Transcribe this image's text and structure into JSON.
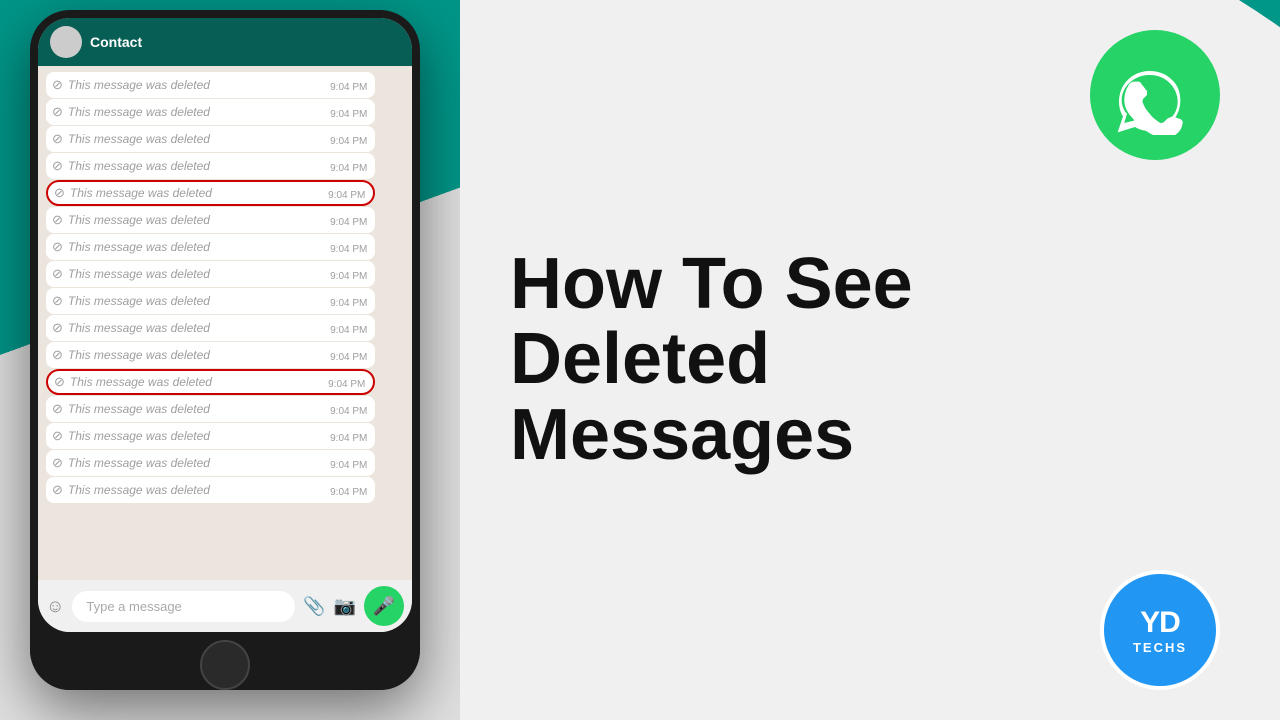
{
  "left": {
    "messages": [
      {
        "text": "This message was deleted",
        "time": "9:04 PM",
        "circled": false
      },
      {
        "text": "This message was deleted",
        "time": "9:04 PM",
        "circled": false
      },
      {
        "text": "This message was deleted",
        "time": "9:04 PM",
        "circled": false
      },
      {
        "text": "This message was deleted",
        "time": "9:04 PM",
        "circled": false
      },
      {
        "text": "This message was deleted",
        "time": "9:04 PM",
        "circled": true
      },
      {
        "text": "This message was deleted",
        "time": "9:04 PM",
        "circled": false
      },
      {
        "text": "This message was deleted",
        "time": "9:04 PM",
        "circled": false
      },
      {
        "text": "This message was deleted",
        "time": "9:04 PM",
        "circled": false
      },
      {
        "text": "This message was deleted",
        "time": "9:04 PM",
        "circled": false
      },
      {
        "text": "This message was deleted",
        "time": "9:04 PM",
        "circled": false
      },
      {
        "text": "This message was deleted",
        "time": "9:04 PM",
        "circled": false
      },
      {
        "text": "This message was deleted",
        "time": "9:04 PM",
        "circled": true
      },
      {
        "text": "This message was deleted",
        "time": "9:04 PM",
        "circled": false
      },
      {
        "text": "This message was deleted",
        "time": "9:04 PM",
        "circled": false
      },
      {
        "text": "This message was deleted",
        "time": "9:04 PM",
        "circled": false
      },
      {
        "text": "This message was deleted",
        "time": "9:04 PM",
        "circled": false
      }
    ],
    "input_placeholder": "Type a message"
  },
  "right": {
    "line1": "How To See",
    "line2": "Deleted",
    "line3": "Messages"
  },
  "whatsapp": {
    "phone_icon": "📞"
  },
  "yd": {
    "top": "YD",
    "bottom": "TECHS"
  }
}
